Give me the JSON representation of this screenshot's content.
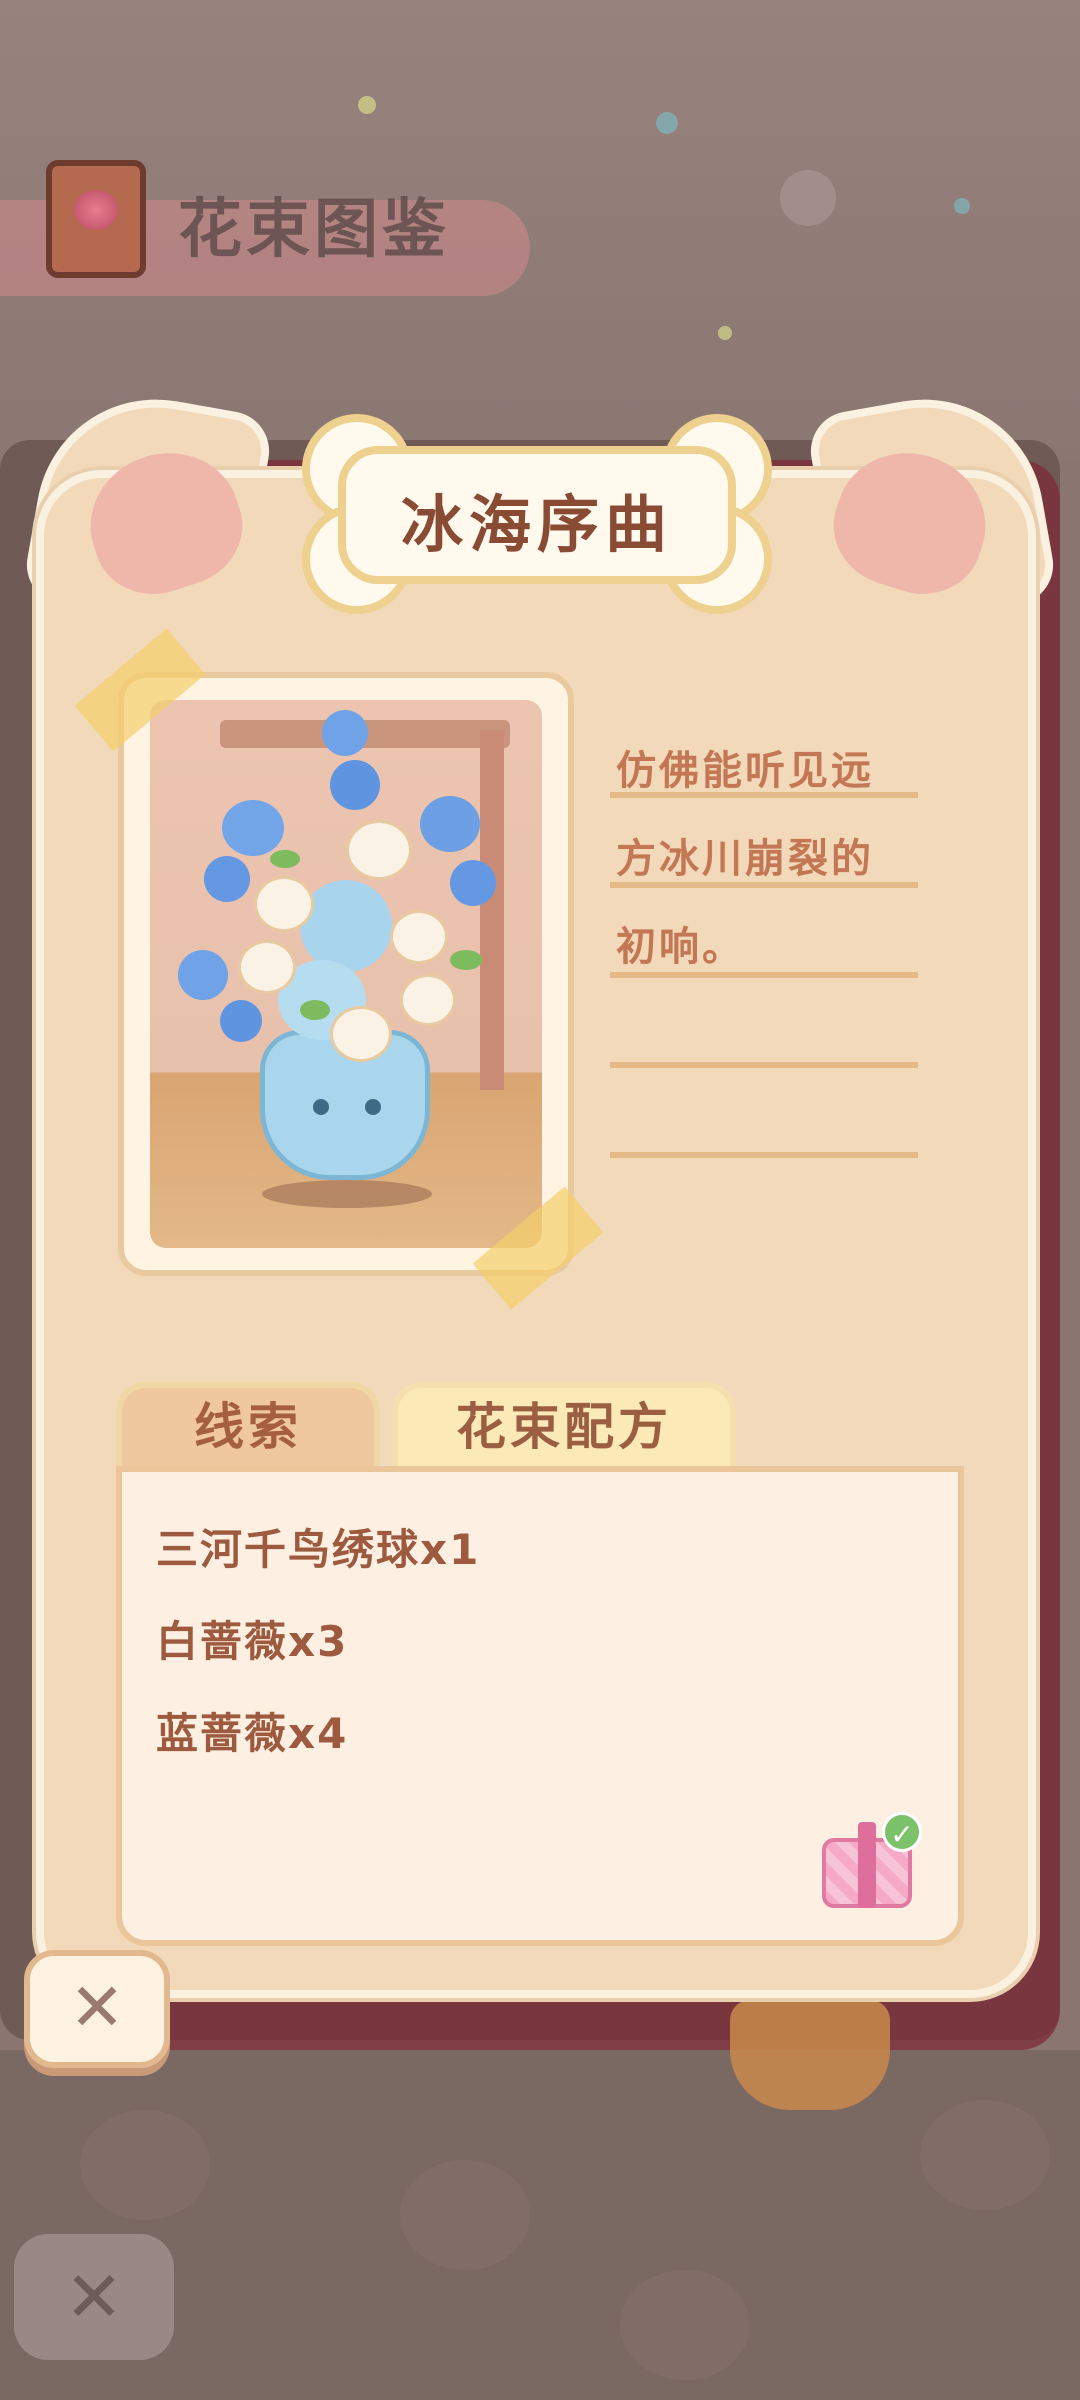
{
  "book": {
    "title": "花束图鉴"
  },
  "bouquet": {
    "name": "冰海序曲",
    "description_lines": [
      "仿佛能听见远",
      "方冰川崩裂的",
      "初响。",
      "",
      ""
    ]
  },
  "tabs": {
    "clue_label": "线索",
    "recipe_label": "花束配方"
  },
  "recipe": {
    "items": [
      "三河千鸟绣球x1",
      "白蔷薇x3",
      "蓝蔷薇x4"
    ]
  },
  "buttons": {
    "close_label": "✕"
  },
  "colors": {
    "card_bg": "#f1d9b9",
    "accent_brown": "#8a4b35",
    "desc_text": "#c47755",
    "gift_pink": "#f5a9c6",
    "check_green": "#7cc26a"
  },
  "icons": {
    "book": "flower-book-icon",
    "gift": "gift-box-icon",
    "check": "check-badge-icon",
    "close": "close-icon"
  }
}
